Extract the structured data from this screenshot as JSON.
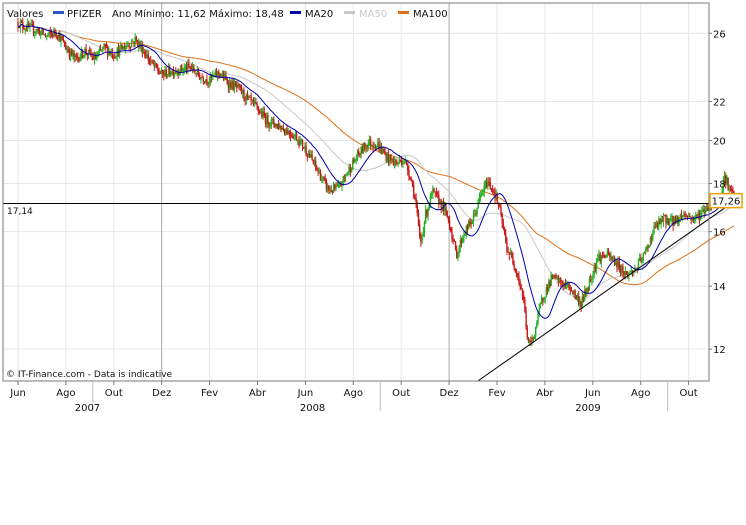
{
  "chart_data": {
    "type": "line",
    "title": "",
    "legend": [
      {
        "name": "Valores",
        "color": "#000000"
      },
      {
        "name": "PFIZER",
        "color": "#2a58c4"
      },
      {
        "name": "MA20",
        "color": "#0000aa"
      },
      {
        "name": "MA50",
        "color": "#c8c8c8"
      },
      {
        "name": "MA100",
        "color": "#e07018"
      }
    ],
    "stats_label": "Ano Mínimo: 11,62 Máximo: 18,48",
    "legend_position": "top-left",
    "y_ticks": [
      12,
      14,
      16,
      18,
      20,
      22,
      26
    ],
    "ylim": [
      11.1,
      28.0
    ],
    "y_scale": "log",
    "x_month_labels": [
      "Jun",
      "Ago",
      "Out",
      "Dez",
      "Fev",
      "Abr",
      "Jun",
      "Ago",
      "Out",
      "Dez",
      "Fev",
      "Abr",
      "Jun",
      "Ago",
      "Out"
    ],
    "x_year_labels": [
      "2007",
      "2008",
      "2009"
    ],
    "x_range_months": [
      0,
      30
    ],
    "grid": true,
    "ref_line": {
      "label": "17,14",
      "value": 17.14
    },
    "last_value": {
      "label": "17,26",
      "value": 17.26
    },
    "trendline": {
      "from": {
        "month": 19.2,
        "value": 11.1
      },
      "to": {
        "month": 30.0,
        "value": 17.3
      }
    },
    "watermark": "© IT-Finance.com - Data is indicative",
    "colors": {
      "up": "#22b022",
      "down": "#c81818",
      "ma20": "#0000aa",
      "ma50": "#c8c8c8",
      "ma100": "#e07018",
      "grid": "#e6e6e6",
      "frame": "#7a7a7a"
    },
    "price_anchors": [
      [
        0.0,
        26.7
      ],
      [
        0.3,
        26.4
      ],
      [
        0.8,
        26.2
      ],
      [
        1.2,
        25.8
      ],
      [
        1.6,
        26.1
      ],
      [
        2.0,
        25.1
      ],
      [
        2.4,
        24.4
      ],
      [
        2.8,
        24.9
      ],
      [
        3.2,
        24.4
      ],
      [
        3.6,
        25.1
      ],
      [
        4.0,
        24.7
      ],
      [
        4.5,
        25.2
      ],
      [
        4.9,
        25.6
      ],
      [
        5.2,
        25.0
      ],
      [
        5.6,
        24.1
      ],
      [
        6.0,
        23.5
      ],
      [
        6.4,
        23.7
      ],
      [
        6.8,
        23.8
      ],
      [
        7.2,
        23.9
      ],
      [
        7.6,
        23.4
      ],
      [
        8.0,
        23.2
      ],
      [
        8.4,
        23.6
      ],
      [
        8.8,
        23.0
      ],
      [
        9.2,
        22.7
      ],
      [
        9.6,
        22.1
      ],
      [
        10.0,
        21.6
      ],
      [
        10.4,
        21.0
      ],
      [
        10.8,
        20.8
      ],
      [
        11.2,
        20.5
      ],
      [
        11.6,
        20.2
      ],
      [
        12.0,
        19.6
      ],
      [
        12.4,
        18.8
      ],
      [
        12.8,
        18.0
      ],
      [
        13.0,
        17.7
      ],
      [
        13.4,
        17.8
      ],
      [
        13.8,
        18.6
      ],
      [
        14.2,
        19.3
      ],
      [
        14.6,
        19.9
      ],
      [
        15.0,
        19.8
      ],
      [
        15.4,
        19.2
      ],
      [
        15.8,
        18.9
      ],
      [
        16.1,
        19.1
      ],
      [
        16.4,
        18.3
      ],
      [
        16.6,
        17.2
      ],
      [
        16.8,
        15.5
      ],
      [
        17.0,
        16.6
      ],
      [
        17.3,
        17.6
      ],
      [
        17.7,
        17.1
      ],
      [
        18.0,
        16.4
      ],
      [
        18.3,
        15.1
      ],
      [
        18.6,
        15.9
      ],
      [
        19.0,
        16.5
      ],
      [
        19.3,
        17.4
      ],
      [
        19.6,
        18.1
      ],
      [
        19.9,
        17.6
      ],
      [
        20.1,
        16.9
      ],
      [
        20.4,
        15.4
      ],
      [
        20.8,
        14.6
      ],
      [
        21.1,
        13.6
      ],
      [
        21.3,
        12.1
      ],
      [
        21.5,
        12.3
      ],
      [
        21.9,
        13.6
      ],
      [
        22.3,
        14.3
      ],
      [
        22.7,
        14.1
      ],
      [
        23.1,
        13.9
      ],
      [
        23.5,
        13.4
      ],
      [
        23.8,
        14.0
      ],
      [
        24.2,
        15.0
      ],
      [
        24.6,
        15.1
      ],
      [
        25.0,
        14.8
      ],
      [
        25.4,
        14.4
      ],
      [
        25.8,
        14.6
      ],
      [
        26.2,
        15.2
      ],
      [
        26.6,
        16.2
      ],
      [
        27.0,
        16.5
      ],
      [
        27.4,
        16.4
      ],
      [
        27.8,
        16.7
      ],
      [
        28.2,
        16.5
      ],
      [
        28.6,
        16.8
      ],
      [
        29.0,
        17.2
      ],
      [
        29.3,
        17.4
      ],
      [
        29.5,
        18.3
      ],
      [
        29.7,
        17.8
      ],
      [
        29.9,
        17.3
      ]
    ]
  }
}
